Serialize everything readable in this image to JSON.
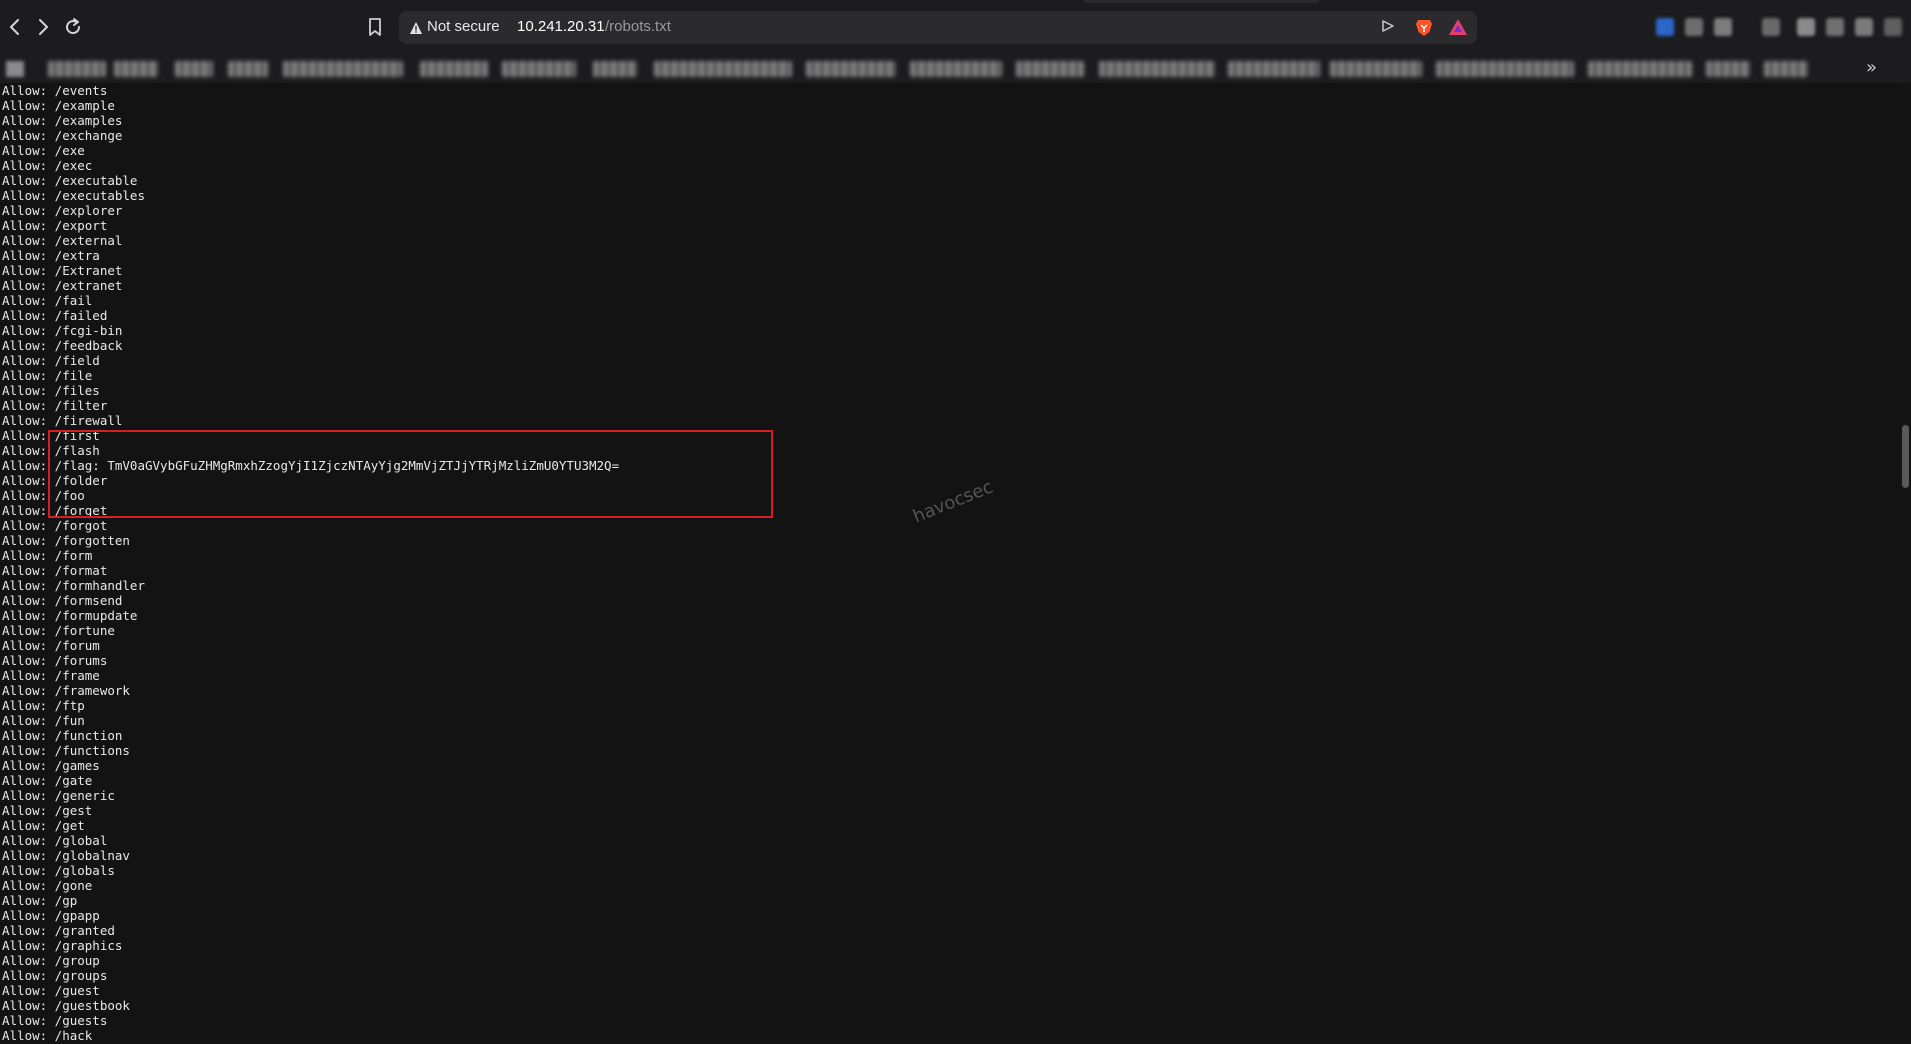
{
  "browser": {
    "address_bar": {
      "security_label": "Not secure",
      "url_host": "10.241.20.31",
      "url_path": "/robots.txt"
    },
    "icons": {
      "back": "back-arrow-icon",
      "forward": "forward-arrow-icon",
      "reload": "reload-icon",
      "bookmark": "bookmark-icon",
      "security": "warning-triangle-icon",
      "share": "share-icon",
      "brave_shields": "brave-shields-icon",
      "brave_rewards": "brave-rewards-icon",
      "bookmarks_overflow": "chevron-double-right-icon"
    },
    "colors": {
      "chrome_bg": "#1c1c1e",
      "page_bg": "#131313",
      "highlight_box": "#d32027",
      "brave_orange": "#fb542b"
    }
  },
  "robots_txt": {
    "lines": [
      "Allow: /events",
      "Allow: /example",
      "Allow: /examples",
      "Allow: /exchange",
      "Allow: /exe",
      "Allow: /exec",
      "Allow: /executable",
      "Allow: /executables",
      "Allow: /explorer",
      "Allow: /export",
      "Allow: /external",
      "Allow: /extra",
      "Allow: /Extranet",
      "Allow: /extranet",
      "Allow: /fail",
      "Allow: /failed",
      "Allow: /fcgi-bin",
      "Allow: /feedback",
      "Allow: /field",
      "Allow: /file",
      "Allow: /files",
      "Allow: /filter",
      "Allow: /firewall",
      "Allow: /first",
      "Allow: /flash",
      "Allow: /flag: TmV0aGVybGFuZHMgRmxhZzogYjI1ZjczNTAyYjg2MmVjZTJjYTRjMzliZmU0YTU3M2Q=",
      "Allow: /folder",
      "Allow: /foo",
      "Allow: /forget",
      "Allow: /forgot",
      "Allow: /forgotten",
      "Allow: /form",
      "Allow: /format",
      "Allow: /formhandler",
      "Allow: /formsend",
      "Allow: /formupdate",
      "Allow: /fortune",
      "Allow: /forum",
      "Allow: /forums",
      "Allow: /frame",
      "Allow: /framework",
      "Allow: /ftp",
      "Allow: /fun",
      "Allow: /function",
      "Allow: /functions",
      "Allow: /games",
      "Allow: /gate",
      "Allow: /generic",
      "Allow: /gest",
      "Allow: /get",
      "Allow: /global",
      "Allow: /globalnav",
      "Allow: /globals",
      "Allow: /gone",
      "Allow: /gp",
      "Allow: /gpapp",
      "Allow: /granted",
      "Allow: /graphics",
      "Allow: /group",
      "Allow: /groups",
      "Allow: /guest",
      "Allow: /guestbook",
      "Allow: /guests",
      "Allow: /hack"
    ]
  },
  "watermark": "havocsec"
}
